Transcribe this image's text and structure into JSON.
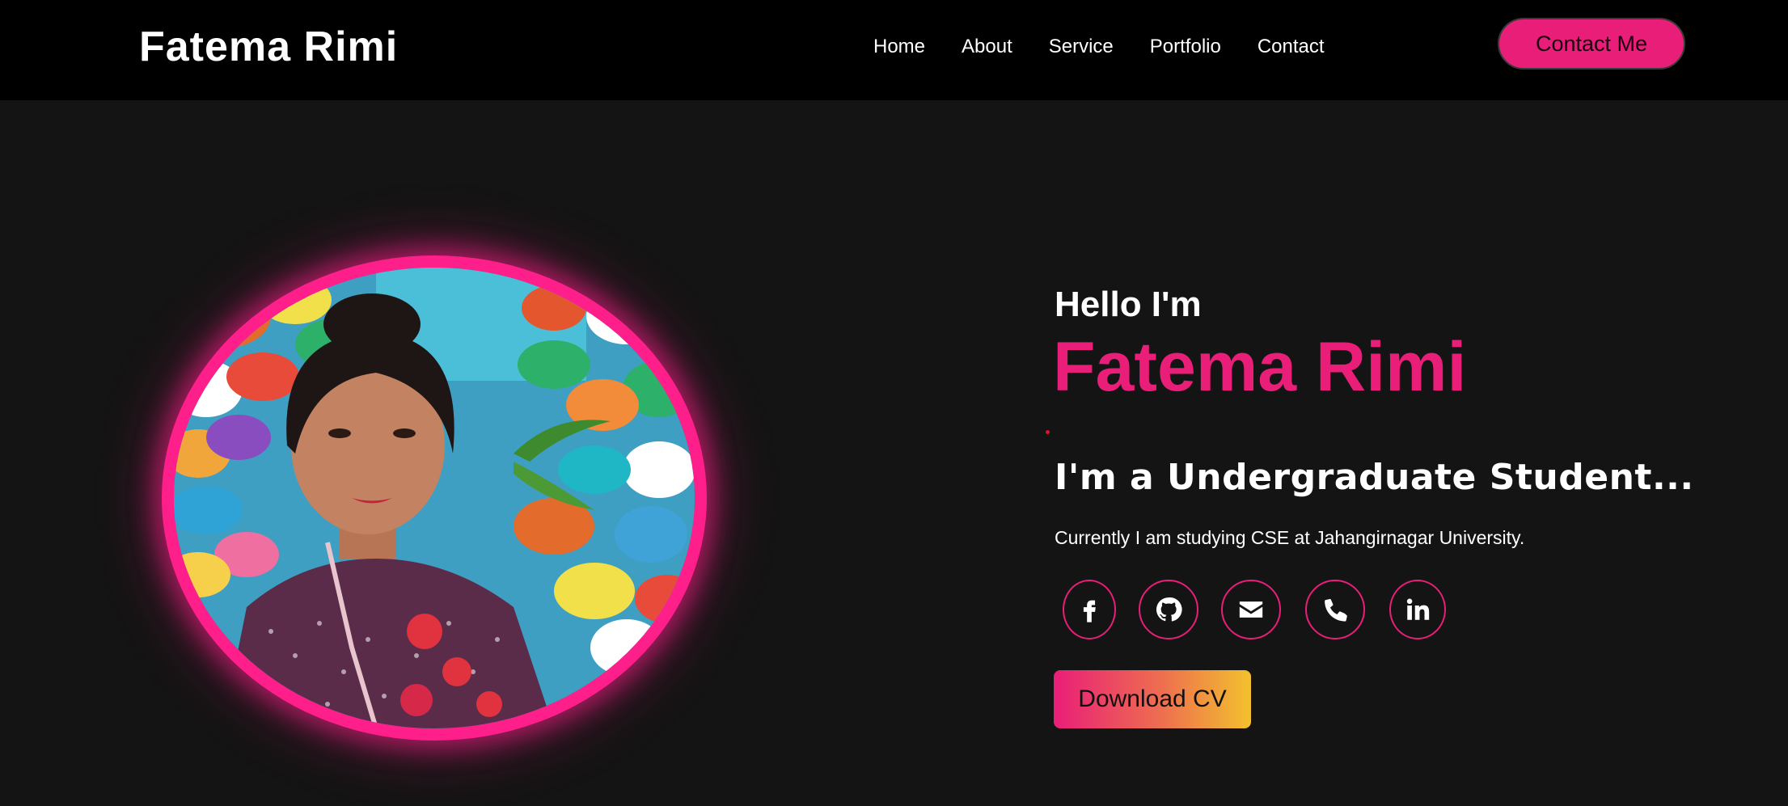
{
  "nav": {
    "brand": "Fatema Rimi",
    "links": [
      "Home",
      "About",
      "Service",
      "Portfolio",
      "Contact"
    ],
    "cta": "Contact Me"
  },
  "hero": {
    "greeting": "Hello I'm",
    "name": "Fatema Rimi",
    "role": "I'm a Undergraduate Student...",
    "description": "Currently I am studying CSE at Jahangirnagar University.",
    "socials": [
      "facebook-icon",
      "github-icon",
      "envelope-icon",
      "phone-icon",
      "linkedin-icon"
    ],
    "download": "Download CV"
  },
  "colors": {
    "accent": "#e91e78",
    "glow": "#ff1f8a",
    "background": "#141414",
    "navbar": "#000000"
  }
}
